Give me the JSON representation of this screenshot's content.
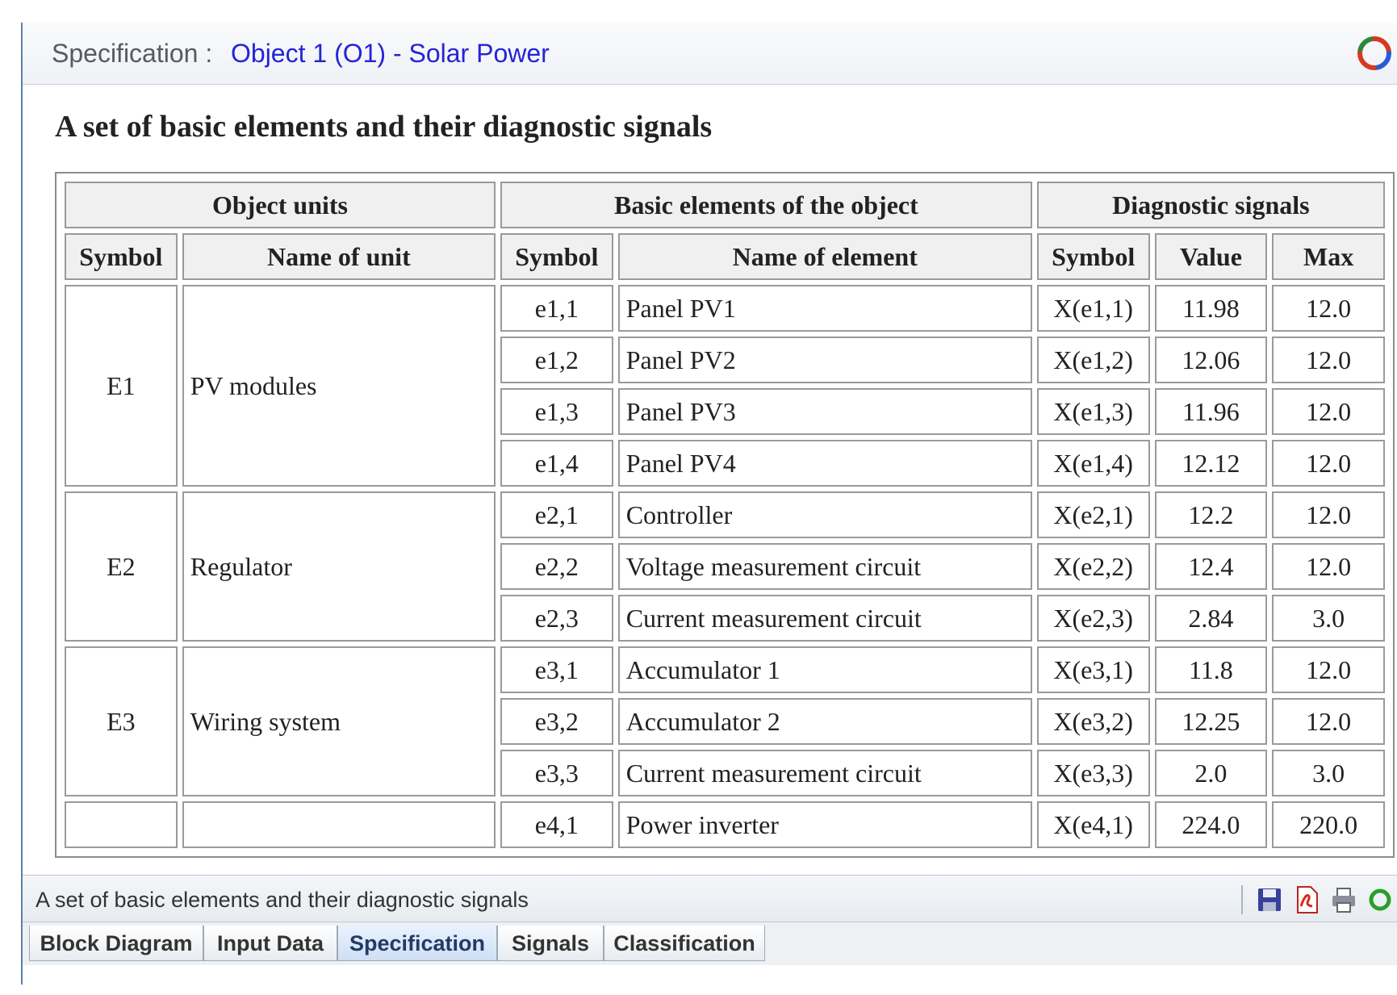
{
  "header": {
    "label": "Specification :",
    "object_title": "Object 1 (O1) - Solar Power"
  },
  "content": {
    "heading": "A set of basic elements and their diagnostic signals"
  },
  "table": {
    "group_headers": [
      "Object units",
      "Basic elements of the object",
      "Diagnostic signals"
    ],
    "column_headers": [
      "Symbol",
      "Name of unit",
      "Symbol",
      "Name of element",
      "Symbol",
      "Value",
      "Max"
    ],
    "units": [
      {
        "symbol": "E1",
        "name": "PV modules",
        "elements": [
          {
            "symbol": "e1,1",
            "name": "Panel PV1",
            "signal": "X(e1,1)",
            "value": "11.98",
            "max": "12.0"
          },
          {
            "symbol": "e1,2",
            "name": "Panel PV2",
            "signal": "X(e1,2)",
            "value": "12.06",
            "max": "12.0"
          },
          {
            "symbol": "e1,3",
            "name": "Panel PV3",
            "signal": "X(e1,3)",
            "value": "11.96",
            "max": "12.0"
          },
          {
            "symbol": "e1,4",
            "name": "Panel PV4",
            "signal": "X(e1,4)",
            "value": "12.12",
            "max": "12.0"
          }
        ]
      },
      {
        "symbol": "E2",
        "name": "Regulator",
        "elements": [
          {
            "symbol": "e2,1",
            "name": "Controller",
            "signal": "X(e2,1)",
            "value": "12.2",
            "max": "12.0"
          },
          {
            "symbol": "e2,2",
            "name": "Voltage measurement circuit",
            "signal": "X(e2,2)",
            "value": "12.4",
            "max": "12.0"
          },
          {
            "symbol": "e2,3",
            "name": "Current measurement circuit",
            "signal": "X(e2,3)",
            "value": "2.84",
            "max": "3.0"
          }
        ]
      },
      {
        "symbol": "E3",
        "name": "Wiring system",
        "elements": [
          {
            "symbol": "e3,1",
            "name": "Accumulator 1",
            "signal": "X(e3,1)",
            "value": "11.8",
            "max": "12.0"
          },
          {
            "symbol": "e3,2",
            "name": "Accumulator 2",
            "signal": "X(e3,2)",
            "value": "12.25",
            "max": "12.0"
          },
          {
            "symbol": "e3,3",
            "name": "Current measurement circuit",
            "signal": "X(e3,3)",
            "value": "2.0",
            "max": "3.0"
          }
        ]
      },
      {
        "symbol": "",
        "name": "",
        "elements": [
          {
            "symbol": "e4,1",
            "name": "Power inverter",
            "signal": "X(e4,1)",
            "value": "224.0",
            "max": "220.0"
          }
        ]
      }
    ]
  },
  "footer": {
    "caption": "A set of basic elements and their diagnostic signals",
    "icons": [
      "save-icon",
      "pdf-icon",
      "print-icon",
      "refresh-icon"
    ]
  },
  "tabs": [
    {
      "label": "Block Diagram",
      "active": false
    },
    {
      "label": "Input Data",
      "active": false
    },
    {
      "label": "Specification",
      "active": true
    },
    {
      "label": "Signals",
      "active": false
    },
    {
      "label": "Classification",
      "active": false
    }
  ],
  "colors": {
    "title_blue": "#2424d6",
    "window_border": "#5f7fa8",
    "active_tab": "#cfdff3"
  }
}
